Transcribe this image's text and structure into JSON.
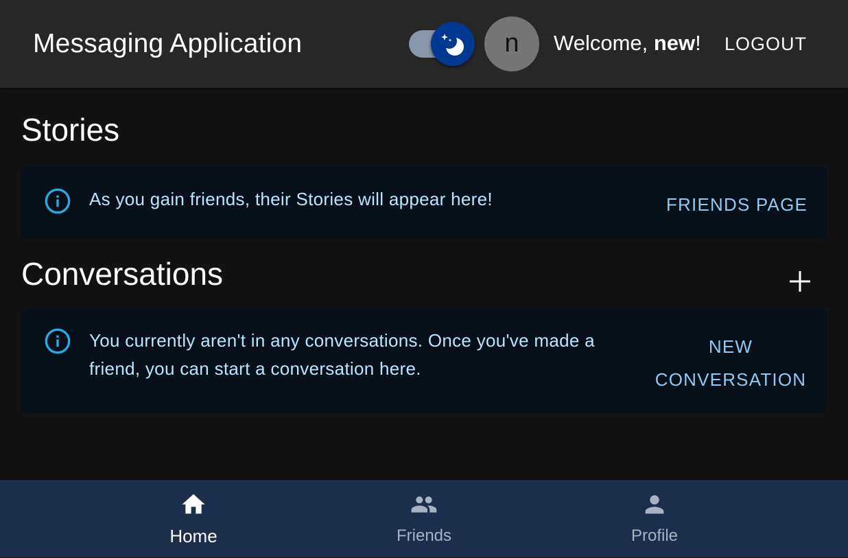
{
  "header": {
    "title": "Messaging Application",
    "theme_toggle": {
      "mode": "dark",
      "checked": true
    },
    "avatar_letter": "n",
    "welcome_prefix": "Welcome, ",
    "username": "new",
    "welcome_suffix": "!",
    "logout_label": "LOGOUT"
  },
  "stories": {
    "heading": "Stories",
    "info_icon": "info-icon",
    "message": "As you gain friends, their Stories will appear here!",
    "action_label": "FRIENDS PAGE"
  },
  "conversations": {
    "heading": "Conversations",
    "add_icon": "plus-icon",
    "info_icon": "info-icon",
    "message": "You currently aren't in any conversations. Once you've made a friend, you can start a conversation here.",
    "action_label": "NEW CONVERSATION"
  },
  "bottom_nav": {
    "items": [
      {
        "label": "Home",
        "icon": "home-icon",
        "active": true
      },
      {
        "label": "Friends",
        "icon": "people-icon",
        "active": false
      },
      {
        "label": "Profile",
        "icon": "person-icon",
        "active": false
      }
    ]
  },
  "colors": {
    "appbar_bg": "#272727",
    "page_bg": "#121212",
    "alert_bg": "#071018",
    "alert_text": "#b8e6fe",
    "info_icon": "#29a9e5",
    "action_text": "#90c9f7",
    "switch_thumb": "#003892",
    "nav_bg": "#1d2d4c"
  }
}
